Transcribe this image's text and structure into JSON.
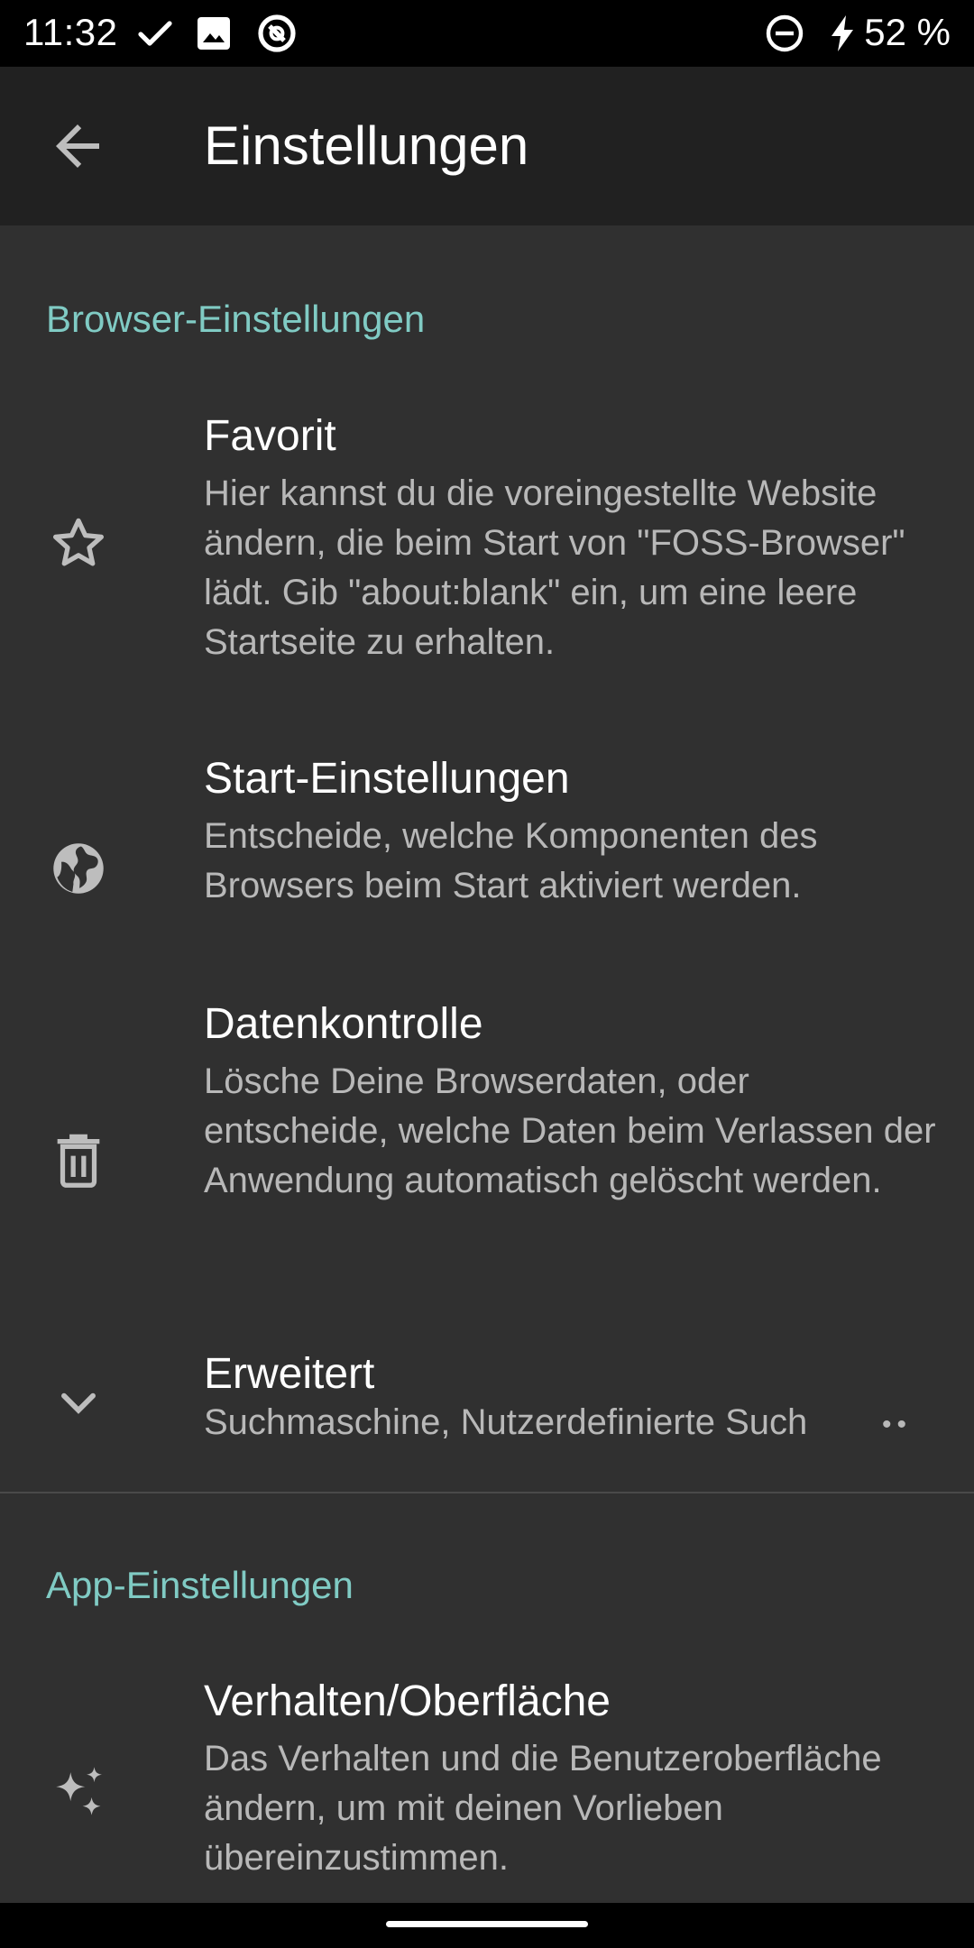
{
  "status_bar": {
    "time": "11:32",
    "battery": "52 %",
    "icons": [
      "check-icon",
      "image-icon",
      "sync-app-icon",
      "do-not-disturb-icon",
      "charging-bolt-icon"
    ]
  },
  "app_bar": {
    "title": "Einstellungen",
    "back_icon": "arrow-back-icon"
  },
  "sections": [
    {
      "header": "Browser-Einstellungen",
      "items": [
        {
          "title": "Favorit",
          "summary": "Hier kannst du die voreingestellte Website ändern, die beim Start von \"FOSS-Browser\" lädt. Gib \"about:blank\" ein, um eine leere Startseite zu erhalten.",
          "icon": "star-icon"
        },
        {
          "title": "Start-Einstellungen",
          "summary": "Entscheide, welche Komponenten des Browsers beim Start aktiviert werden.",
          "icon": "globe-icon"
        },
        {
          "title": "Datenkontrolle",
          "summary": "Lösche Deine Browserdaten, oder entscheide, welche Daten beim Verlassen der Anwendung automatisch gelöscht werden.",
          "icon": "trash-icon"
        },
        {
          "title": "Erweitert",
          "summary": "Suchmaschine, Nutzerdefinierte Such",
          "icon": "chevron-down-icon"
        }
      ]
    },
    {
      "header": "App-Einstellungen",
      "items": [
        {
          "title": "Verhalten/Oberfläche",
          "summary": "Das Verhalten und die Benutzeroberfläche ändern, um mit deinen Vorlieben übereinzustimmen.",
          "icon": "sparkle-icon"
        }
      ]
    }
  ],
  "colors": {
    "background": "#303030",
    "app_bar": "#212121",
    "accent": "#80cbc4",
    "title_text": "#ffffff",
    "summary_text": "#b8b8b8"
  }
}
